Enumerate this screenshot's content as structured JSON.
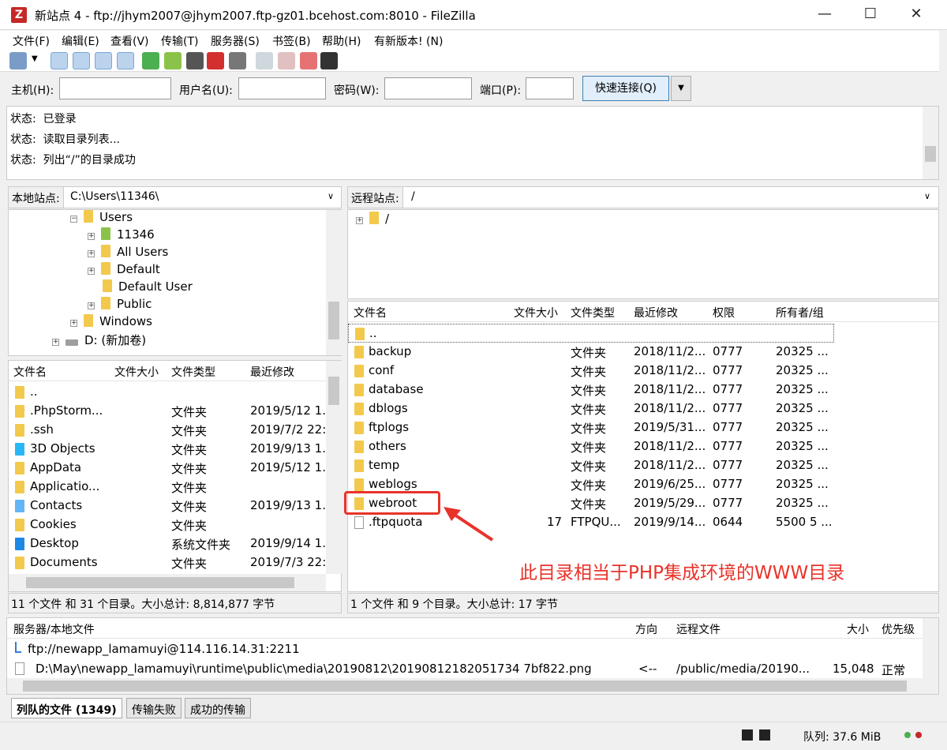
{
  "window": {
    "title": "新站点 4 - ftp://jhym2007@jhym2007.ftp-gz01.bcehost.com:8010 - FileZilla",
    "minimize": "—",
    "maximize": "☐",
    "close": "✕"
  },
  "menu": [
    "文件(F)",
    "编辑(E)",
    "查看(V)",
    "传输(T)",
    "服务器(S)",
    "书签(B)",
    "帮助(H)",
    "有新版本! (N)"
  ],
  "quickconnect": {
    "host_label": "主机(H):",
    "user_label": "用户名(U):",
    "pass_label": "密码(W):",
    "port_label": "端口(P):",
    "connect_label": "快速连接(Q)",
    "host_value": "",
    "user_value": "",
    "pass_value": "",
    "port_value": ""
  },
  "log": [
    {
      "prefix": "状态:",
      "text": "已登录"
    },
    {
      "prefix": "状态:",
      "text": "读取目录列表..."
    },
    {
      "prefix": "状态:",
      "text": "列出“/”的目录成功"
    }
  ],
  "local": {
    "site_label": "本地站点:",
    "path": "C:\\Users\\11346\\",
    "tree": [
      {
        "label": "Users",
        "level": 3
      },
      {
        "label": "11346",
        "level": 4
      },
      {
        "label": "All Users",
        "level": 4
      },
      {
        "label": "Default",
        "level": 4
      },
      {
        "label": "Default User",
        "level": 4
      },
      {
        "label": "Public",
        "level": 4
      },
      {
        "label": "Windows",
        "level": 3
      },
      {
        "label": "D: (新加卷)",
        "level": 2
      }
    ],
    "columns": [
      "文件名",
      "文件大小",
      "文件类型",
      "最近修改"
    ],
    "files": [
      {
        "name": "..",
        "size": "",
        "type": "",
        "modified": ""
      },
      {
        "name": ".PhpStorm...",
        "size": "",
        "type": "文件夹",
        "modified": "2019/5/12 1..."
      },
      {
        "name": ".ssh",
        "size": "",
        "type": "文件夹",
        "modified": "2019/7/2 22:.."
      },
      {
        "name": "3D Objects",
        "size": "",
        "type": "文件夹",
        "modified": "2019/9/13 1..."
      },
      {
        "name": "AppData",
        "size": "",
        "type": "文件夹",
        "modified": "2019/5/12 1..."
      },
      {
        "name": "Applicatio...",
        "size": "",
        "type": "文件夹",
        "modified": ""
      },
      {
        "name": "Contacts",
        "size": "",
        "type": "文件夹",
        "modified": "2019/9/13 1..."
      },
      {
        "name": "Cookies",
        "size": "",
        "type": "文件夹",
        "modified": ""
      },
      {
        "name": "Desktop",
        "size": "",
        "type": "系统文件夹",
        "modified": "2019/9/14 1..."
      },
      {
        "name": "Documents",
        "size": "",
        "type": "文件夹",
        "modified": "2019/7/3 22:.."
      }
    ],
    "status": "11 个文件 和 31 个目录。大小总计: 8,814,877 字节"
  },
  "remote": {
    "site_label": "远程站点:",
    "path": "/",
    "tree_root": "/",
    "columns": [
      "文件名",
      "文件大小",
      "文件类型",
      "最近修改",
      "权限",
      "所有者/组"
    ],
    "files": [
      {
        "name": "..",
        "size": "",
        "type": "",
        "modified": "",
        "perm": "",
        "owner": ""
      },
      {
        "name": "backup",
        "size": "",
        "type": "文件夹",
        "modified": "2018/11/2...",
        "perm": "0777",
        "owner": "20325 ..."
      },
      {
        "name": "conf",
        "size": "",
        "type": "文件夹",
        "modified": "2018/11/2...",
        "perm": "0777",
        "owner": "20325 ..."
      },
      {
        "name": "database",
        "size": "",
        "type": "文件夹",
        "modified": "2018/11/2...",
        "perm": "0777",
        "owner": "20325 ..."
      },
      {
        "name": "dblogs",
        "size": "",
        "type": "文件夹",
        "modified": "2018/11/2...",
        "perm": "0777",
        "owner": "20325 ..."
      },
      {
        "name": "ftplogs",
        "size": "",
        "type": "文件夹",
        "modified": "2019/5/31...",
        "perm": "0777",
        "owner": "20325 ..."
      },
      {
        "name": "others",
        "size": "",
        "type": "文件夹",
        "modified": "2018/11/2...",
        "perm": "0777",
        "owner": "20325 ..."
      },
      {
        "name": "temp",
        "size": "",
        "type": "文件夹",
        "modified": "2018/11/2...",
        "perm": "0777",
        "owner": "20325 ..."
      },
      {
        "name": "weblogs",
        "size": "",
        "type": "文件夹",
        "modified": "2019/6/25...",
        "perm": "0777",
        "owner": "20325 ..."
      },
      {
        "name": "webroot",
        "size": "",
        "type": "文件夹",
        "modified": "2019/5/29...",
        "perm": "0777",
        "owner": "20325 ..."
      },
      {
        "name": ".ftpquota",
        "size": "17",
        "type": "FTPQU...",
        "modified": "2019/9/14...",
        "perm": "0644",
        "owner": "5500 5 ..."
      }
    ],
    "status": "1 个文件 和 9 个目录。大小总计: 17 字节"
  },
  "queue": {
    "columns": [
      "服务器/本地文件",
      "方向",
      "远程文件",
      "大小",
      "优先级"
    ],
    "server": "ftp://newapp_lamamuyi@114.116.14.31:2211",
    "file": {
      "local": "D:\\May\\newapp_lamamuyi\\runtime\\public\\media\\20190812\\20190812182051734 7bf822.png",
      "direction": "<--",
      "remote": "/public/media/20190...",
      "size": "15,048",
      "priority": "正常"
    }
  },
  "tabs": [
    "列队的文件 (1349)",
    "传输失败",
    "成功的传输"
  ],
  "bottom": {
    "queue": "队列: 37.6 MiB"
  },
  "annotation": "此目录相当于PHP集成环境的WWW目录",
  "colors": {
    "annotation": "#e8332a",
    "folder": "#f2c94c"
  }
}
